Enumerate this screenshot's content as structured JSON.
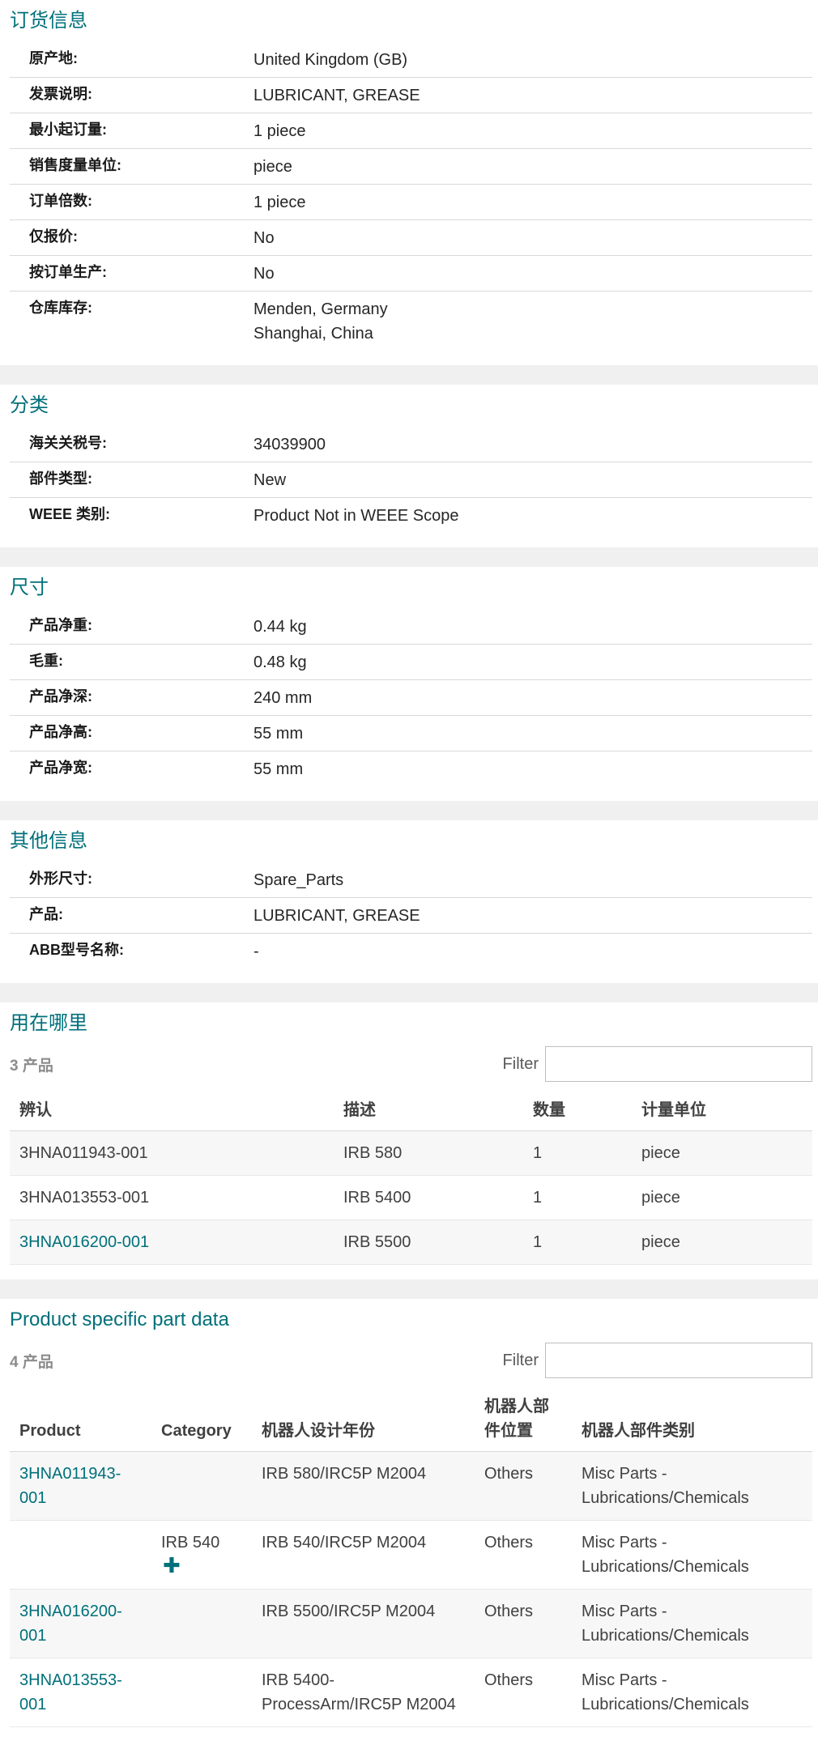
{
  "ordering": {
    "title": "订货信息",
    "rows": [
      {
        "label": "原产地:",
        "values": [
          "United Kingdom (GB)"
        ]
      },
      {
        "label": "发票说明:",
        "values": [
          "LUBRICANT, GREASE"
        ]
      },
      {
        "label": "最小起订量:",
        "values": [
          "1 piece"
        ]
      },
      {
        "label": "销售度量单位:",
        "values": [
          "piece"
        ]
      },
      {
        "label": "订单倍数:",
        "values": [
          "1 piece"
        ]
      },
      {
        "label": "仅报价:",
        "values": [
          "No"
        ]
      },
      {
        "label": "按订单生产:",
        "values": [
          "No"
        ]
      },
      {
        "label": "仓库库存:",
        "values": [
          "Menden, Germany",
          "Shanghai, China"
        ]
      }
    ]
  },
  "classification": {
    "title": "分类",
    "rows": [
      {
        "label": "海关关税号:",
        "values": [
          "34039900"
        ]
      },
      {
        "label": "部件类型:",
        "values": [
          "New"
        ]
      },
      {
        "label": "WEEE 类别:",
        "values": [
          "Product Not in WEEE Scope"
        ]
      }
    ]
  },
  "dimensions": {
    "title": "尺寸",
    "rows": [
      {
        "label": "产品净重:",
        "values": [
          "0.44 kg"
        ]
      },
      {
        "label": "毛重:",
        "values": [
          "0.48 kg"
        ]
      },
      {
        "label": "产品净深:",
        "values": [
          "240 mm"
        ]
      },
      {
        "label": "产品净高:",
        "values": [
          "55 mm"
        ]
      },
      {
        "label": "产品净宽:",
        "values": [
          "55 mm"
        ]
      }
    ]
  },
  "other": {
    "title": "其他信息",
    "rows": [
      {
        "label": "外形尺寸:",
        "values": [
          "Spare_Parts"
        ]
      },
      {
        "label": "产品:",
        "values": [
          "LUBRICANT, GREASE"
        ]
      },
      {
        "label": "ABB型号名称:",
        "values": [
          "-"
        ]
      }
    ]
  },
  "where_used": {
    "title": "用在哪里",
    "count": "3 产品",
    "filter_label": "Filter",
    "filter_value": "",
    "columns": [
      "辨认",
      "描述",
      "数量",
      "计量单位"
    ],
    "rows": [
      {
        "id": "3HNA011943-001",
        "desc": "IRB 580",
        "qty": "1",
        "unit": "piece",
        "link": false
      },
      {
        "id": "3HNA013553-001",
        "desc": "IRB 5400",
        "qty": "1",
        "unit": "piece",
        "link": false
      },
      {
        "id": "3HNA016200-001",
        "desc": "IRB 5500",
        "qty": "1",
        "unit": "piece",
        "link": true
      }
    ]
  },
  "specific": {
    "title": "Product specific part data",
    "count": "4 产品",
    "filter_label": "Filter",
    "filter_value": "",
    "columns": [
      "Product",
      "Category",
      "机器人设计年份",
      "机器人部件位置",
      "机器人部件类别"
    ],
    "rows": [
      {
        "product": "3HNA011943-001",
        "category": "",
        "expand": false,
        "year": "IRB 580/IRC5P M2004",
        "position": "Others",
        "type": "Misc Parts - Lubrications/Chemicals"
      },
      {
        "product": "",
        "category": "IRB 540",
        "expand": true,
        "year": "IRB 540/IRC5P M2004",
        "position": "Others",
        "type": "Misc Parts - Lubrications/Chemicals"
      },
      {
        "product": "3HNA016200-001",
        "category": "",
        "expand": false,
        "year": "IRB 5500/IRC5P M2004",
        "position": "Others",
        "type": "Misc Parts - Lubrications/Chemicals"
      },
      {
        "product": "3HNA013553-001",
        "category": "",
        "expand": false,
        "year": "IRB 5400-ProcessArm/IRC5P M2004",
        "position": "Others",
        "type": "Misc Parts - Lubrications/Chemicals"
      }
    ]
  }
}
